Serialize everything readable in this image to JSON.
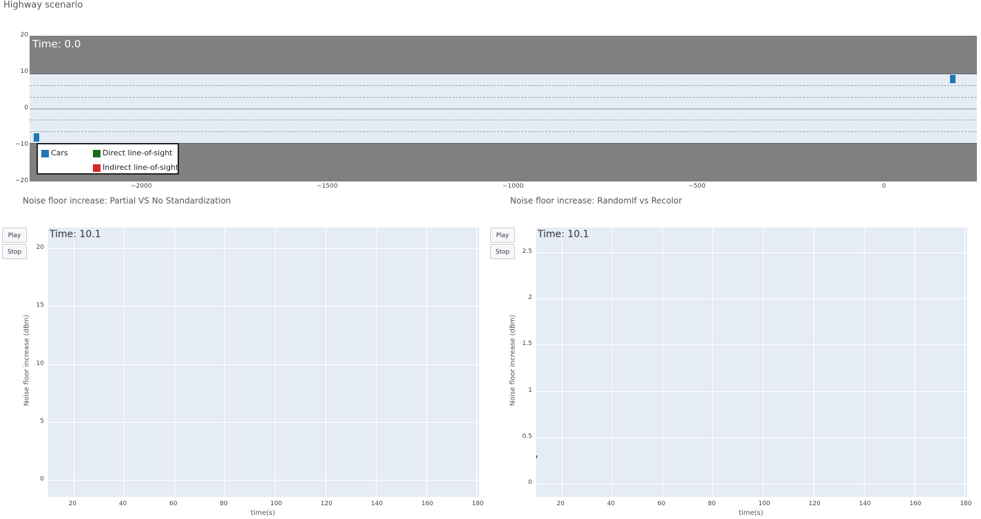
{
  "page_title": "Highway scenario",
  "highway": {
    "time_label": "Time: 0.0",
    "x_ticks": [
      "−2000",
      "−1500",
      "−1000",
      "−500",
      "0"
    ],
    "y_ticks": [
      "20",
      "10",
      "0",
      "−10",
      "−20"
    ],
    "legend": {
      "items": [
        {
          "label": "Cars",
          "color": "#1f77b4"
        },
        {
          "label": "Direct line-of-sight",
          "color": "#1a6e1a"
        },
        {
          "label": "Indirect line-of-sight",
          "color": "#d62728"
        }
      ]
    },
    "cars": [
      {
        "x": -2410,
        "y": -8
      },
      {
        "x": 190,
        "y": 8
      }
    ],
    "colors": {
      "shoulder": "#808080",
      "road": "#e5ecf6",
      "car": "#1f77b4"
    }
  },
  "chart_left": {
    "title": "Noise floor increase: Partial VS No Standardization",
    "time_label": "Time: 10.1",
    "play_label": "Play",
    "stop_label": "Stop",
    "ylabel": "Noise floor increase (dBm)",
    "xlabel": "time(s)",
    "y_ticks": [
      "20",
      "15",
      "10",
      "5",
      "0"
    ],
    "x_ticks": [
      "20",
      "40",
      "60",
      "80",
      "100",
      "120",
      "140",
      "160",
      "180"
    ]
  },
  "chart_right": {
    "title": "Noise floor increase: RandomIf vs Recolor",
    "time_label": "Time: 10.1",
    "play_label": "Play",
    "stop_label": "Stop",
    "ylabel": "Noise floor increase (dBm)",
    "xlabel": "time(s)",
    "y_ticks": [
      "2.5",
      "2",
      "1.5",
      "1",
      "0.5",
      "0"
    ],
    "x_ticks": [
      "20",
      "40",
      "60",
      "80",
      "100",
      "120",
      "140",
      "160",
      "180"
    ]
  },
  "chart_data": [
    {
      "type": "line",
      "title": "Noise floor increase: Partial VS No Standardization",
      "xlabel": "time(s)",
      "ylabel": "Noise floor increase (dBm)",
      "xlim": [
        10,
        181
      ],
      "ylim": [
        -1.5,
        21.8
      ],
      "grid": true,
      "series": []
    },
    {
      "type": "line",
      "title": "Noise floor increase: RandomIf vs Recolor",
      "xlabel": "time(s)",
      "ylabel": "Noise floor increase (dBm)",
      "xlim": [
        10,
        181
      ],
      "ylim": [
        -0.15,
        2.77
      ],
      "grid": true,
      "series": [
        {
          "x": [
            10,
            10.2
          ],
          "y": [
            0.27,
            0.3
          ]
        }
      ]
    }
  ]
}
